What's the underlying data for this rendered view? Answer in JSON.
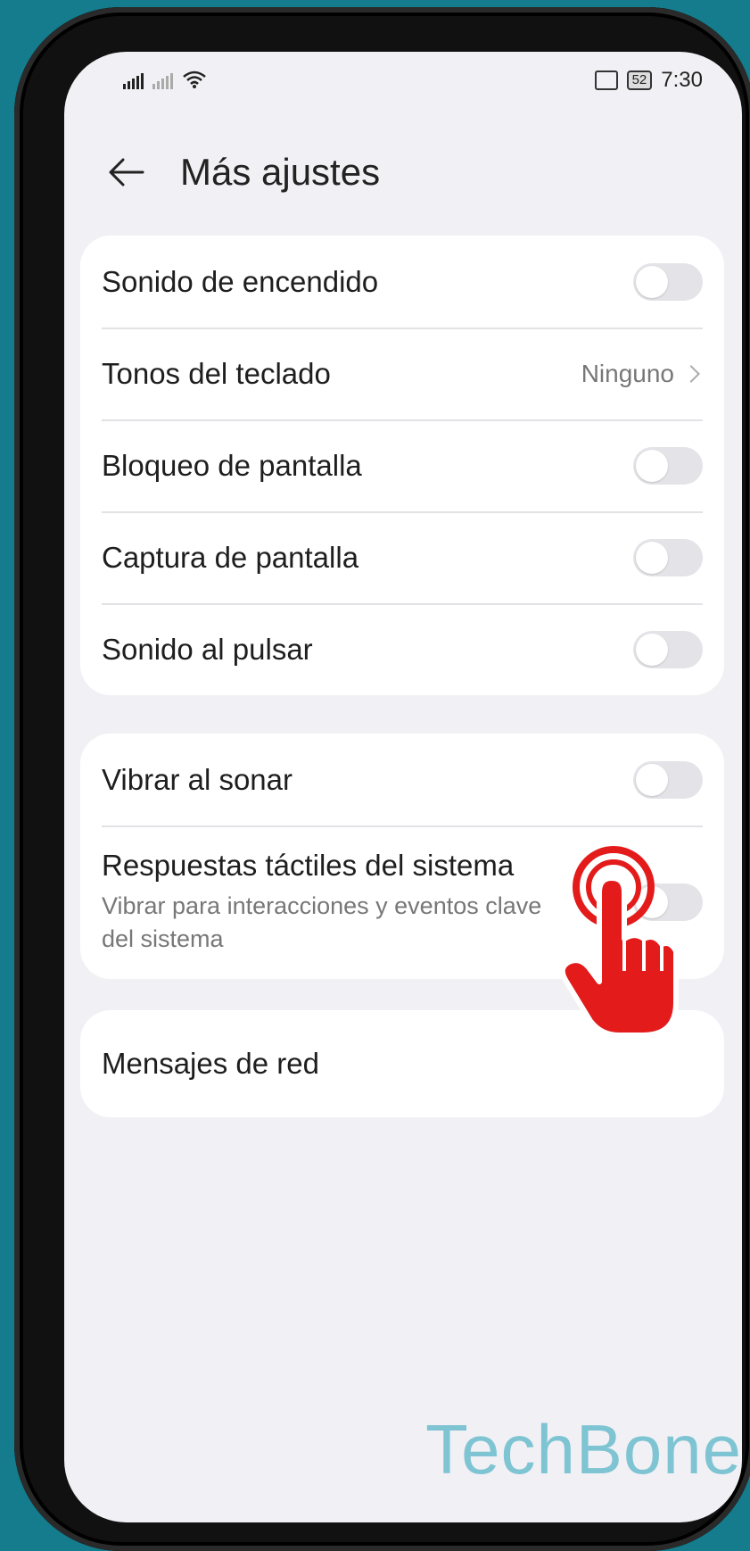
{
  "status_bar": {
    "time": "7:30",
    "battery": "52",
    "icons": [
      "signal-icon",
      "signal-no-service-icon",
      "wifi-icon",
      "cast-icon",
      "battery-icon"
    ]
  },
  "header": {
    "title": "Más ajustes",
    "back_icon": "arrow-left-icon"
  },
  "card1": {
    "rows": [
      {
        "label": "Sonido de encendido",
        "control": "toggle",
        "on": false
      },
      {
        "label": "Tonos del teclado",
        "control": "value",
        "value": "Ninguno"
      },
      {
        "label": "Bloqueo de pantalla",
        "control": "toggle",
        "on": false
      },
      {
        "label": "Captura de pantalla",
        "control": "toggle",
        "on": false
      },
      {
        "label": "Sonido al pulsar",
        "control": "toggle",
        "on": false
      }
    ]
  },
  "card2": {
    "rows": [
      {
        "label": "Vibrar al sonar",
        "control": "toggle",
        "on": false
      },
      {
        "label": "Respuestas táctiles del sistema",
        "subtitle": "Vibrar para interacciones y eventos clave del sistema",
        "control": "toggle",
        "on": false
      }
    ]
  },
  "card3": {
    "rows": [
      {
        "label": "Mensajes de red"
      }
    ]
  },
  "overlay": {
    "hand_icon": "tap-hand-icon",
    "color": "#e31b1b"
  },
  "watermark": "TechBone"
}
